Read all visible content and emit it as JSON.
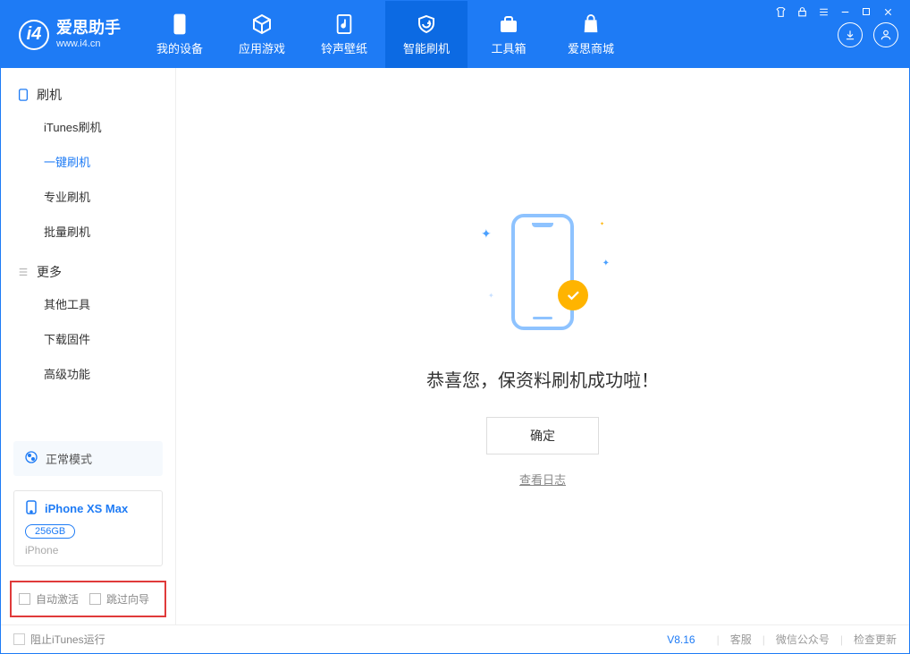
{
  "app": {
    "title": "爱思助手",
    "subtitle": "www.i4.cn"
  },
  "tabs": [
    {
      "label": "我的设备"
    },
    {
      "label": "应用游戏"
    },
    {
      "label": "铃声壁纸"
    },
    {
      "label": "智能刷机"
    },
    {
      "label": "工具箱"
    },
    {
      "label": "爱思商城"
    }
  ],
  "sidebar": {
    "group1": {
      "title": "刷机"
    },
    "items1": [
      {
        "label": "iTunes刷机"
      },
      {
        "label": "一键刷机"
      },
      {
        "label": "专业刷机"
      },
      {
        "label": "批量刷机"
      }
    ],
    "group2": {
      "title": "更多"
    },
    "items2": [
      {
        "label": "其他工具"
      },
      {
        "label": "下载固件"
      },
      {
        "label": "高级功能"
      }
    ],
    "mode": "正常模式",
    "device": {
      "name": "iPhone XS Max",
      "storage": "256GB",
      "type": "iPhone"
    },
    "checks": {
      "auto_activate": "自动激活",
      "skip_guide": "跳过向导"
    }
  },
  "main": {
    "message": "恭喜您，保资料刷机成功啦！",
    "ok": "确定",
    "view_log": "查看日志"
  },
  "footer": {
    "block_itunes": "阻止iTunes运行",
    "version": "V8.16",
    "links": [
      "客服",
      "微信公众号",
      "检查更新"
    ]
  }
}
